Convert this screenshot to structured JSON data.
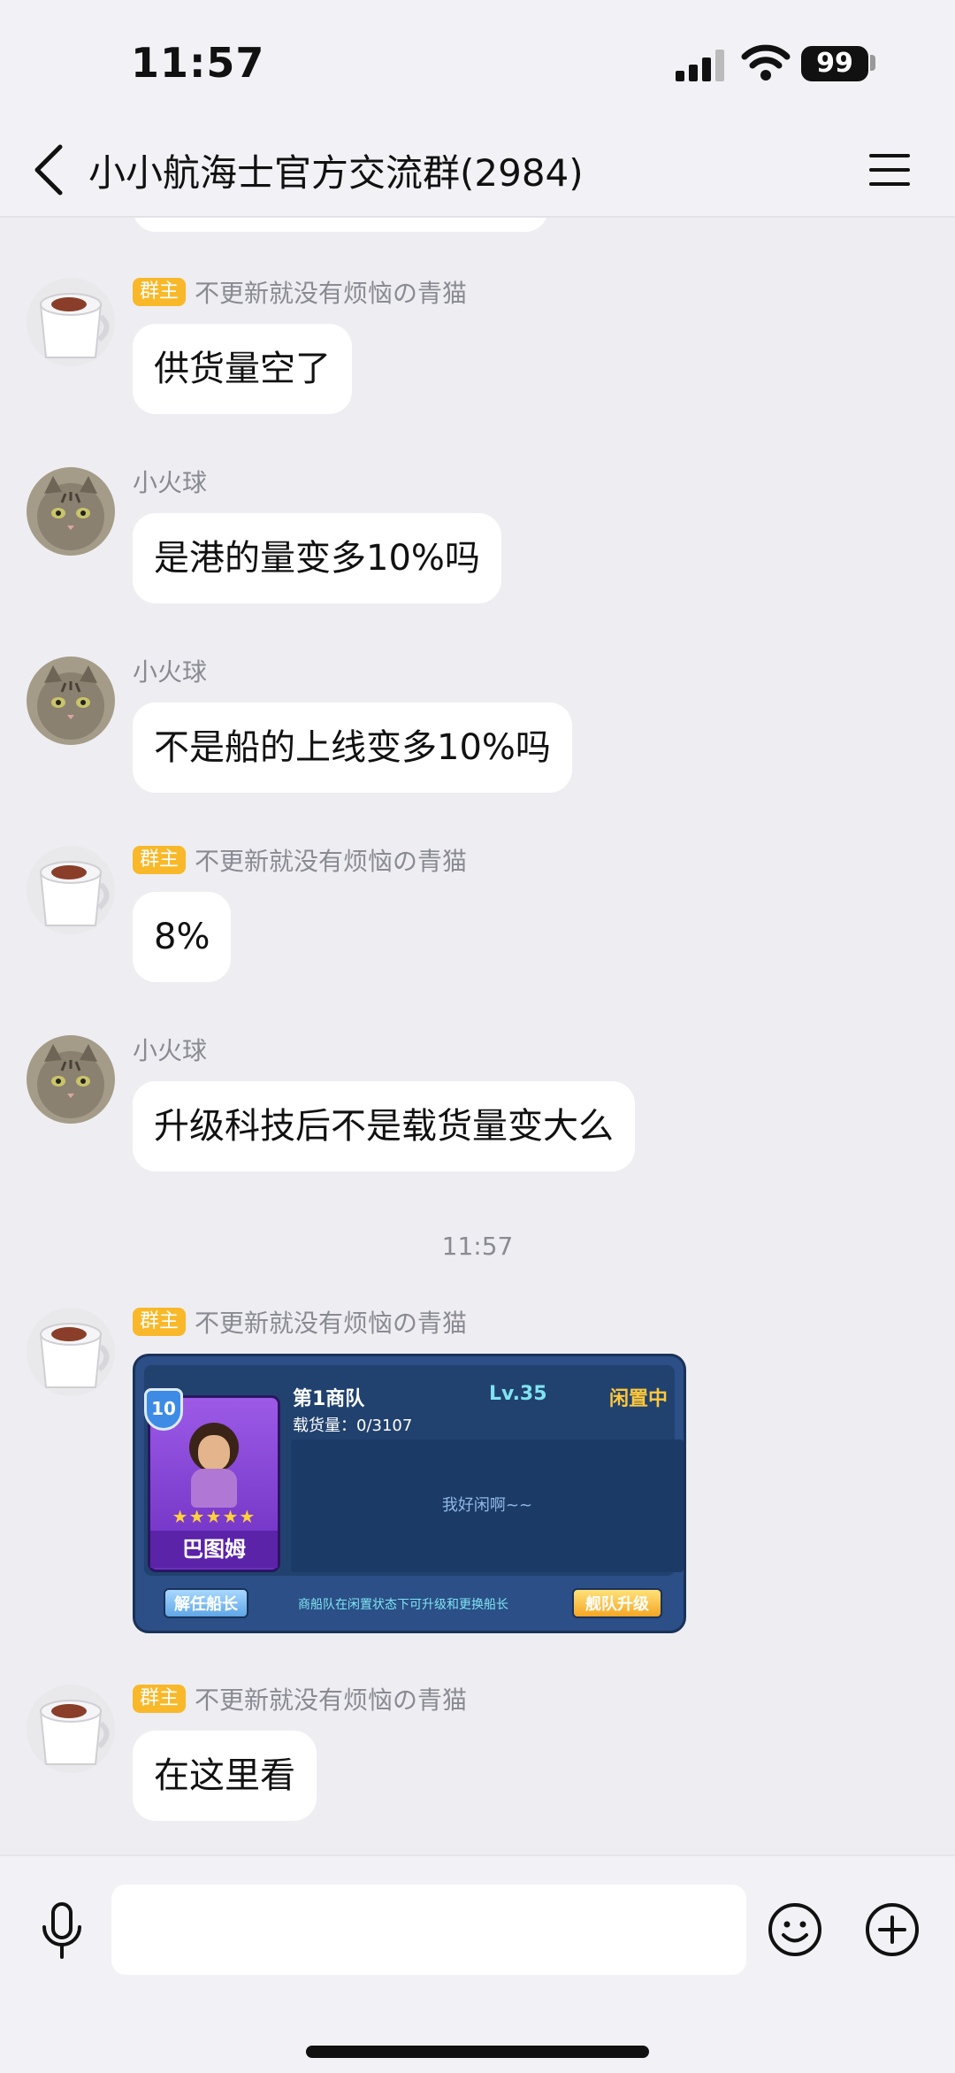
{
  "status_bar": {
    "time": "11:57",
    "battery": "99"
  },
  "header": {
    "title": "小小航海士官方交流群(2984)"
  },
  "owner_badge": "群主",
  "timestamp": "11:57",
  "messages": [
    {
      "sender": "不更新就没有烦恼の青猫",
      "is_owner": true,
      "text": "供货量空了"
    },
    {
      "sender": "小火球",
      "is_owner": false,
      "text": "是港的量变多10%吗"
    },
    {
      "sender": "小火球",
      "is_owner": false,
      "text": "不是船的上线变多10%吗"
    },
    {
      "sender": "不更新就没有烦恼の青猫",
      "is_owner": true,
      "text": "8%"
    },
    {
      "sender": "小火球",
      "is_owner": false,
      "text": "升级科技后不是载货量变大么"
    },
    {
      "sender": "不更新就没有烦恼の青猫",
      "is_owner": true,
      "type": "image"
    },
    {
      "sender": "不更新就没有烦恼の青猫",
      "is_owner": true,
      "text": "在这里看"
    }
  ],
  "game_card": {
    "level_badge": "10",
    "fleet_name": "第1商队",
    "level": "Lv.35",
    "state": "闲置中",
    "cargo": "载货量：0/3107",
    "idle_text": "我好闲啊~~",
    "character_name": "巴图姆",
    "stars": "★★★★★",
    "dismiss_button": "解任船长",
    "hint": "商船队在闲置状态下可升级和更换船长",
    "upgrade_button": "舰队升级"
  },
  "input": {
    "placeholder": ""
  },
  "colors": {
    "background": "#EEEEF2",
    "badge": "#F8B829",
    "bubble": "#FFFFFF"
  }
}
